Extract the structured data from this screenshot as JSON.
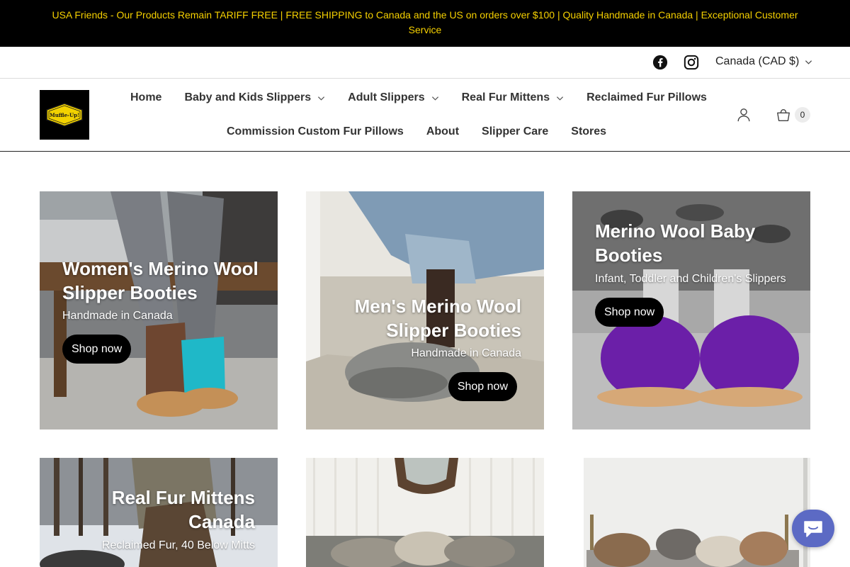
{
  "announcement": "USA Friends - Our Products Remain TARIFF FREE | FREE SHIPPING to Canada and the US on orders over $100 | Quality Handmade in Canada | Exceptional Customer Service",
  "utility": {
    "social_icons": [
      "facebook-icon",
      "instagram-icon"
    ],
    "currency": "Canada (CAD $)"
  },
  "header": {
    "logo_text": "Muffle-Up!",
    "nav_row1": [
      {
        "label": "Home"
      },
      {
        "label": "Baby and Kids Slippers"
      },
      {
        "label": "Adult Slippers"
      },
      {
        "label": "Real Fur Mittens"
      },
      {
        "label": "Reclaimed Fur Pillows"
      }
    ],
    "nav_row2": [
      {
        "label": "Commission Custom Fur Pillows"
      },
      {
        "label": "About"
      },
      {
        "label": "Slipper Care"
      },
      {
        "label": "Stores"
      }
    ],
    "cart_count": "0"
  },
  "tiles": [
    {
      "title": "Women's Merino Wool Slipper Booties",
      "subtitle": "Handmade in Canada",
      "button": "Shop now"
    },
    {
      "title": "Men's Merino Wool Slipper Booties",
      "subtitle": "Handmade in Canada",
      "button": "Shop now"
    },
    {
      "title": "Merino Wool Baby Booties",
      "subtitle": "Infant, Toddler and Children's Slippers",
      "button": "Shop now"
    },
    {
      "title": "Real Fur Mittens Canada",
      "subtitle": "Reclaimed Fur, 40 Below Mitts"
    },
    {},
    {}
  ],
  "colors": {
    "announcement_bg": "#000000",
    "announcement_text": "#f5d000",
    "button_bg": "#000000",
    "chat_bubble": "#5c6ac4"
  }
}
